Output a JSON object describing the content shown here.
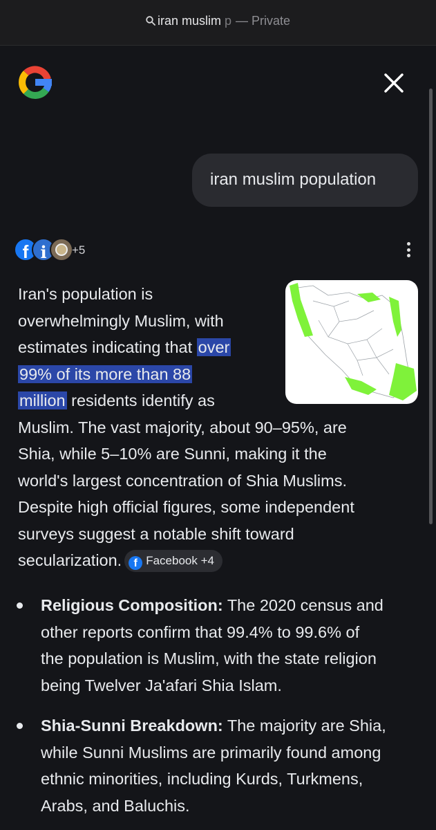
{
  "browser": {
    "url_query": "iran muslim",
    "url_query_fade": "p",
    "mode_label": "— Private"
  },
  "search": {
    "query": "iran muslim population"
  },
  "sources": {
    "more_count": "+5"
  },
  "answer": {
    "lines": [
      "Iran's population is",
      "overwhelmingly Muslim, with",
      "estimates indicating that ",
      "over",
      "99% of its more than 88",
      "million",
      " residents identify as",
      "Muslim. The vast majority, about 90–95%, are",
      "Shia, while 5–10% are Sunni, making it the",
      "world's largest concentration of Shia Muslims.",
      "Despite high official figures, some independent",
      "surveys suggest a notable shift toward",
      "secularization."
    ],
    "source_chip": "Facebook +4"
  },
  "bullets": [
    {
      "title": "Religious Composition:",
      "lines": [
        " The 2020 census and",
        "other reports confirm that 99.4% to 99.6% of",
        "the population is Muslim, with the state religion",
        "being Twelver Ja'afari Shia Islam."
      ]
    },
    {
      "title": "Shia-Sunni Breakdown:",
      "lines": [
        " The majority are Shia,",
        "while Sunni Muslims are primarily found among",
        "ethnic minorities, including Kurds, Turkmens,",
        "Arabs, and Baluchis."
      ]
    }
  ],
  "colors": {
    "background": "#141519",
    "highlight": "#2b47a8",
    "map_green": "#7ff23a"
  }
}
